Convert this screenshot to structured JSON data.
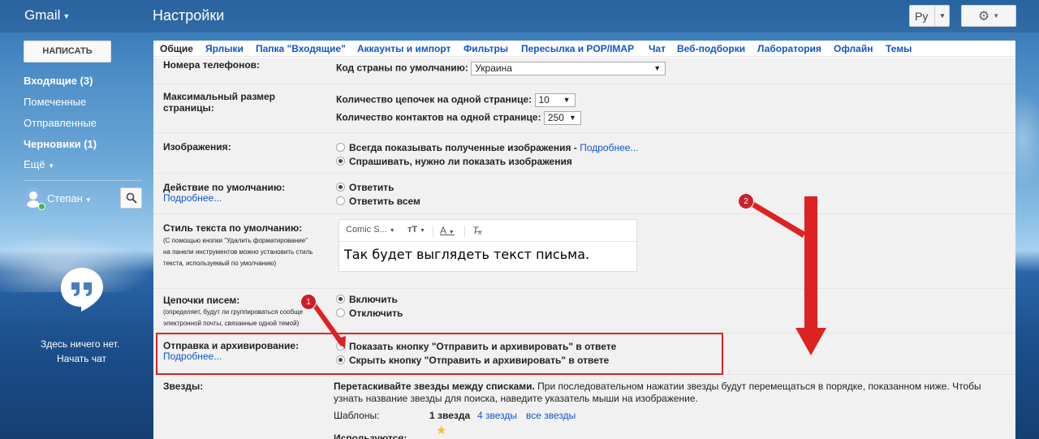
{
  "header": {
    "logo": "Gmail",
    "title": "Настройки",
    "language": "Ру"
  },
  "sidebar": {
    "compose": "НАПИСАТЬ",
    "items": [
      {
        "label": "Входящие (3)",
        "bold": true
      },
      {
        "label": "Помеченные",
        "bold": false
      },
      {
        "label": "Отправленные",
        "bold": false
      },
      {
        "label": "Черновики (1)",
        "bold": true
      },
      {
        "label": "Ещё",
        "bold": false
      }
    ],
    "user": "Степан",
    "chat_empty": "Здесь ничего нет.",
    "start_chat": "Начать чат"
  },
  "tabs": [
    "Общие",
    "Ярлыки",
    "Папка \"Входящие\"",
    "Аккаунты и импорт",
    "Фильтры",
    "Пересылка и POP/IMAP",
    "Чат",
    "Веб-подборки",
    "Лаборатория",
    "Офлайн",
    "Темы"
  ],
  "settings": {
    "phone": {
      "label": "Номера телефонов:",
      "field": "Код страны по умолчанию:",
      "value": "Украина"
    },
    "page_size": {
      "label": "Максимальный размер",
      "label2": "страницы:",
      "threads_label": "Количество цепочек на одной странице:",
      "threads_value": "10",
      "contacts_label": "Количество контактов на одной странице:",
      "contacts_value": "250"
    },
    "images": {
      "label": "Изображения:",
      "option1": "Всегда показывать полученные изображения - ",
      "option1_link": "Подробнее...",
      "option2": "Спрашивать, нужно ли показать изображения"
    },
    "default_action": {
      "label": "Действие по умолчанию:",
      "link": "Подробнее...",
      "option1": "Ответить",
      "option2": "Ответить всем"
    },
    "text_style": {
      "label": "Стиль текста по умолчанию:",
      "desc1": "(С помощью кнопки \"Удалить форматирование\"",
      "desc2": "на панели инструментов можно установить стиль",
      "desc3": "текста, используемый по умолчанию)",
      "font": "Comic S...",
      "preview": "Так будет выглядеть текст письма."
    },
    "threads": {
      "label": "Цепочки писем:",
      "desc1": "(определяет, будут ли группироваться сообще",
      "desc2": "электронной почты, связанные одной темой)",
      "option1": "Включить",
      "option2": "Отключить"
    },
    "send_archive": {
      "label": "Отправка и архивирование:",
      "link": "Подробнее...",
      "option1": "Показать кнопку \"Отправить и архивировать\" в ответе",
      "option2": "Скрыть кнопку \"Отправить и архивировать\" в ответе"
    },
    "stars": {
      "label": "Звезды:",
      "text_bold": "Перетаскивайте звезды между списками.",
      "text1": " При последовательном нажатии звезды будут перемещаться в порядке, показанном ниже. Чтобы",
      "text2": "узнать название звезды для поиска, наведите указатель мыши на изображение.",
      "templates_label": "Шаблоны:",
      "preset1": "1 звезда",
      "preset2": "4 звезды",
      "preset3": "все звезды",
      "in_use": "Используются:"
    }
  },
  "annotations": {
    "callout1": "1",
    "callout2": "2",
    "accent_color": "#d22222"
  }
}
